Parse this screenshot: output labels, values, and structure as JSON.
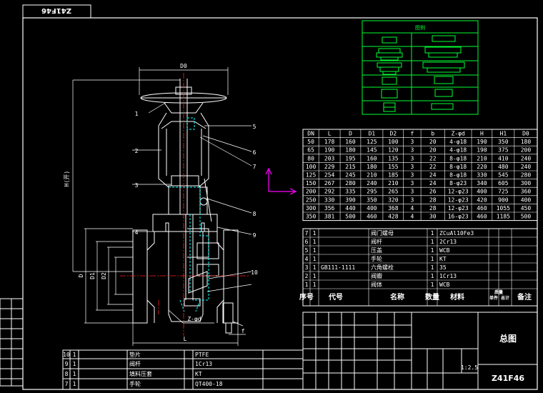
{
  "drawing_number": "Z41F46",
  "title_block": {
    "drawing_title": "总图",
    "drawing_number": "Z41F46",
    "scale": "1:2.5"
  },
  "legend_title": "图例",
  "spec_table": {
    "headers": [
      "DN",
      "L",
      "D",
      "D1",
      "D2",
      "f",
      "b",
      "Z-φd",
      "H",
      "H1",
      "D0"
    ],
    "rows": [
      [
        "50",
        "178",
        "160",
        "125",
        "100",
        "3",
        "20",
        "4-φ18",
        "190",
        "350",
        "180"
      ],
      [
        "65",
        "190",
        "180",
        "145",
        "120",
        "3",
        "20",
        "4-φ18",
        "190",
        "375",
        "200"
      ],
      [
        "80",
        "203",
        "195",
        "160",
        "135",
        "3",
        "22",
        "8-φ18",
        "210",
        "410",
        "240"
      ],
      [
        "100",
        "229",
        "215",
        "180",
        "155",
        "3",
        "22",
        "8-φ18",
        "220",
        "480",
        "240"
      ],
      [
        "125",
        "254",
        "245",
        "210",
        "185",
        "3",
        "24",
        "8-φ18",
        "330",
        "545",
        "280"
      ],
      [
        "150",
        "267",
        "280",
        "240",
        "210",
        "3",
        "24",
        "8-φ23",
        "340",
        "605",
        "300"
      ],
      [
        "200",
        "292",
        "335",
        "295",
        "265",
        "3",
        "26",
        "12-φ23",
        "400",
        "725",
        "360"
      ],
      [
        "250",
        "330",
        "390",
        "350",
        "320",
        "3",
        "28",
        "12-φ23",
        "420",
        "900",
        "400"
      ],
      [
        "300",
        "356",
        "440",
        "400",
        "368",
        "4",
        "28",
        "12-φ23",
        "460",
        "1055",
        "450"
      ],
      [
        "350",
        "381",
        "500",
        "460",
        "428",
        "4",
        "30",
        "16-φ23",
        "460",
        "1185",
        "500"
      ]
    ]
  },
  "parts_list": {
    "rows": [
      [
        "7",
        "1",
        "",
        "阀门螺母",
        "1",
        "ZCuAl10Fe3",
        "",
        "",
        ""
      ],
      [
        "6",
        "1",
        "",
        "阀杆",
        "1",
        "2Cr13",
        "",
        "",
        ""
      ],
      [
        "5",
        "1",
        "",
        "压盖",
        "1",
        "WCB",
        "",
        "",
        ""
      ],
      [
        "4",
        "1",
        "",
        "手轮",
        "1",
        "KT",
        "",
        "",
        ""
      ],
      [
        "3",
        "1",
        "GB111-1111",
        "六角螺栓",
        "1",
        "35",
        "",
        "",
        ""
      ],
      [
        "2",
        "1",
        "",
        "阀瓣",
        "1",
        "1Cr13",
        "",
        "",
        ""
      ],
      [
        "1",
        "1",
        "",
        "阀体",
        "1",
        "WCB",
        "",
        "",
        ""
      ]
    ],
    "header": [
      "序号",
      "代号",
      "名称",
      "数量",
      "材料",
      "单件",
      "总计",
      "备注"
    ],
    "mass_label": "质量"
  },
  "bottom_parts": {
    "headers": [
      "序号",
      "数量",
      "名称",
      "材料"
    ],
    "rows": [
      [
        "9",
        "1",
        "阀杆",
        "1Cr13"
      ],
      [
        "8",
        "1",
        "填料压套",
        "KT"
      ],
      [
        "7",
        "1",
        "手轮",
        "QT400-18"
      ]
    ],
    "col1": "10",
    "name1": "垫片",
    "mat1": "PTFE",
    "num": "1"
  },
  "balloons": [
    "1",
    "2",
    "3",
    "4",
    "5",
    "6",
    "7",
    "8",
    "9",
    "10"
  ],
  "dims": {
    "top": "D0",
    "height": "H(开)",
    "left_1": "D",
    "left_2": "D1",
    "left_3": "D2",
    "bottom_len": "L",
    "holes": "Z-φd",
    "small": "f"
  },
  "colors": {
    "background": "#000000",
    "lines": "#ffffff",
    "legend": "#00ff33",
    "center": "#ff0000",
    "hidden": "#00ffff",
    "axis_marker": "#ff00ff"
  }
}
